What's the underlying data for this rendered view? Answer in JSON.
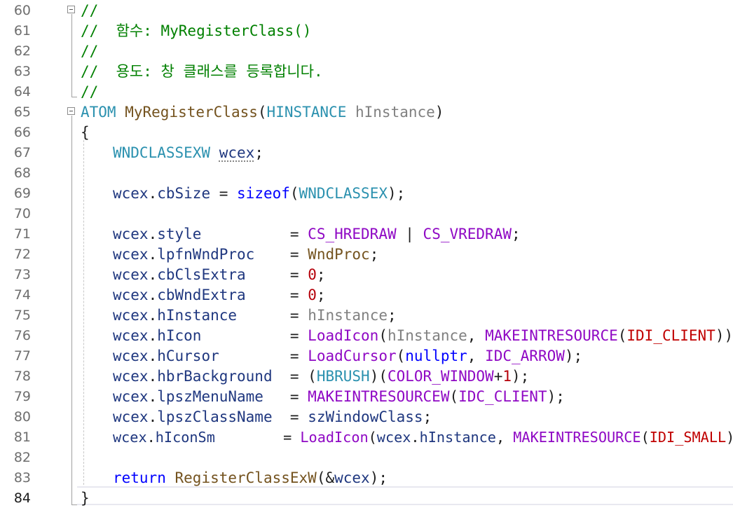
{
  "editor": {
    "lines": [
      {
        "num": "60",
        "text": "//"
      },
      {
        "num": "61",
        "text": "//  함수: MyRegisterClass()"
      },
      {
        "num": "62",
        "text": "//"
      },
      {
        "num": "63",
        "text": "//  용도: 창 클래스를 등록합니다."
      },
      {
        "num": "64",
        "text": "//"
      },
      {
        "num": "65",
        "text": "ATOM MyRegisterClass(HINSTANCE hInstance)"
      },
      {
        "num": "66",
        "text": "{"
      },
      {
        "num": "67",
        "text": "WNDCLASSEXW wcex;"
      },
      {
        "num": "68",
        "text": ""
      },
      {
        "num": "69",
        "text": "wcex.cbSize = sizeof(WNDCLASSEX);"
      },
      {
        "num": "70",
        "text": ""
      },
      {
        "num": "71",
        "text": "wcex.style          = CS_HREDRAW | CS_VREDRAW;"
      },
      {
        "num": "72",
        "text": "wcex.lpfnWndProc    = WndProc;"
      },
      {
        "num": "73",
        "text": "wcex.cbClsExtra     = 0;"
      },
      {
        "num": "74",
        "text": "wcex.cbWndExtra     = 0;"
      },
      {
        "num": "75",
        "text": "wcex.hInstance      = hInstance;"
      },
      {
        "num": "76",
        "text": "wcex.hIcon          = LoadIcon(hInstance, MAKEINTRESOURCE(IDI_CLIENT));"
      },
      {
        "num": "77",
        "text": "wcex.hCursor        = LoadCursor(nullptr, IDC_ARROW);"
      },
      {
        "num": "78",
        "text": "wcex.hbrBackground  = (HBRUSH)(COLOR_WINDOW+1);"
      },
      {
        "num": "79",
        "text": "wcex.lpszMenuName   = MAKEINTRESOURCEW(IDC_CLIENT);"
      },
      {
        "num": "80",
        "text": "wcex.lpszClassName  = szWindowClass;"
      },
      {
        "num": "81",
        "text": "wcex.hIconSm        = LoadIcon(wcex.hInstance, MAKEINTRESOURCE(IDI_SMALL));"
      },
      {
        "num": "82",
        "text": ""
      },
      {
        "num": "83",
        "text": "return RegisterClassExW(&wcex);"
      },
      {
        "num": "84",
        "text": "}"
      }
    ],
    "fold_icons": [
      "collapse-icon",
      "collapse-icon"
    ],
    "colors": {
      "comment": "#008000",
      "keyword": "#0000ff",
      "type": "#2b91af",
      "function": "#74531f",
      "macro": "#8f08c4",
      "number": "#b5000a",
      "variable": "#1f377f"
    }
  }
}
